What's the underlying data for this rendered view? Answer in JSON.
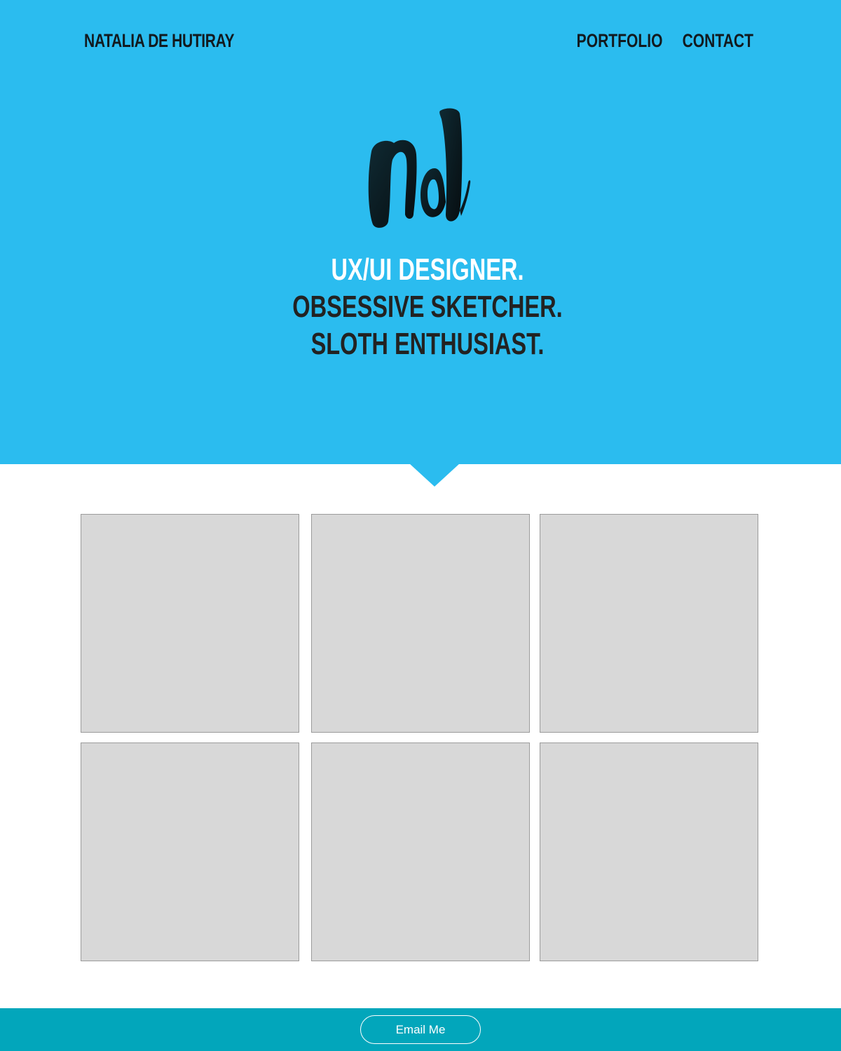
{
  "header": {
    "brand": "NATALIA DE HUTIRAY",
    "nav": [
      {
        "label": "PORTFOLIO"
      },
      {
        "label": "CONTACT"
      }
    ]
  },
  "hero": {
    "logo_icon": "nd-monogram-logo",
    "taglines": [
      "UX/UI DESIGNER.",
      "OBSESSIVE SKETCHER.",
      "SLOTH ENTHUSIAST."
    ]
  },
  "footer": {
    "email_label": "Email Me"
  },
  "colors": {
    "hero_bg": "#2bbcef",
    "footer_bg": "#02a6bb",
    "tile_bg": "#d8d8d8",
    "text_dark": "#121a1f"
  }
}
